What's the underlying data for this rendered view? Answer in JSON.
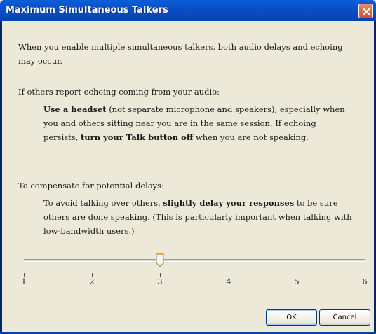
{
  "window": {
    "title": "Maximum Simultaneous Talkers"
  },
  "content": {
    "intro": "When you enable multiple simultaneous talkers, both audio delays and echoing may occur.",
    "echo_heading": "If others report echoing coming from your audio:",
    "echo_advice": {
      "bold1": "Use a headset",
      "text1": " (not separate microphone and speakers), especially when you and others sitting near you are in the same session. If echoing persists, ",
      "bold2": "turn your Talk button off",
      "text2": " when you are not speaking."
    },
    "delay_heading": "To compensate for potential delays:",
    "delay_advice": {
      "text1": "To avoid talking over others, ",
      "bold1": "slightly delay your responses",
      "text2": " to be sure others are done speaking. (This is particularly important when talking with low-bandwidth users.)"
    }
  },
  "slider": {
    "min": 1,
    "max": 6,
    "value": 3,
    "ticks": [
      "1",
      "2",
      "3",
      "4",
      "5",
      "6"
    ]
  },
  "buttons": {
    "ok_label": "OK",
    "cancel_label": "Cancel"
  }
}
